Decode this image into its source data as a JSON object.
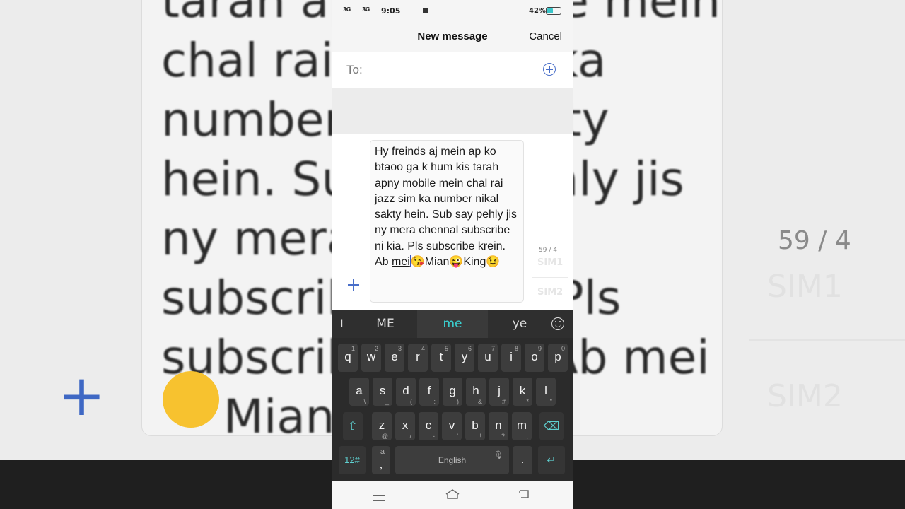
{
  "status_bar": {
    "signal_1": "3G",
    "signal_2": "3G",
    "time": "9:05",
    "battery": "42%"
  },
  "header": {
    "title": "New message",
    "cancel_label": "Cancel"
  },
  "recipient": {
    "label": "To:"
  },
  "compose": {
    "message_main": "Hy freinds aj mein  ap ko btaoo ga k hum kis tarah apny mobile mein chal rai jazz sim ka number  nikal sakty hein. Sub say pehly jis ny mera chennal subscribe  ni kia. Pls subscribe krein. Ab ",
    "message_underlined": "mei",
    "message_tail_1": "😘",
    "message_word_1": "Mian",
    "message_tail_2": "😜",
    "message_word_2": "King",
    "message_tail_3": "😉",
    "char_counter": "59 / 4",
    "sim1_label": "SIM1",
    "sim2_label": "SIM2"
  },
  "keyboard": {
    "suggestions": [
      "ME",
      "me",
      "ye"
    ],
    "row1": [
      {
        "k": "q",
        "s": "1"
      },
      {
        "k": "w",
        "s": "2"
      },
      {
        "k": "e",
        "s": "3"
      },
      {
        "k": "r",
        "s": "4"
      },
      {
        "k": "t",
        "s": "5"
      },
      {
        "k": "y",
        "s": "6"
      },
      {
        "k": "u",
        "s": "7"
      },
      {
        "k": "i",
        "s": "8"
      },
      {
        "k": "o",
        "s": "9"
      },
      {
        "k": "p",
        "s": "0"
      }
    ],
    "row2": [
      {
        "k": "a",
        "s": "\\"
      },
      {
        "k": "s",
        "s": "_"
      },
      {
        "k": "d",
        "s": "("
      },
      {
        "k": "f",
        "s": ":"
      },
      {
        "k": "g",
        "s": ")"
      },
      {
        "k": "h",
        "s": "&"
      },
      {
        "k": "j",
        "s": "#"
      },
      {
        "k": "k",
        "s": "*"
      },
      {
        "k": "l",
        "s": "\""
      }
    ],
    "row3": [
      {
        "k": "z",
        "s": "@"
      },
      {
        "k": "x",
        "s": "/"
      },
      {
        "k": "c",
        "s": "-"
      },
      {
        "k": "v",
        "s": "'"
      },
      {
        "k": "b",
        "s": "!"
      },
      {
        "k": "n",
        "s": "?"
      },
      {
        "k": "m",
        "s": ";"
      }
    ],
    "symbols_label": "12#",
    "comma_label": ",",
    "lang_key_label": "a",
    "space_label": "English",
    "period_label": "."
  },
  "background": {
    "lines": [
      "tarah apny mobile mein",
      "chal rai jazz sim ka",
      "number  nikal sakty",
      "hein. Sub say pehly jis",
      "ny mera chennal",
      "subscribe  ni kia. Pls",
      "subscribe krein. Ab mei",
      "Mian"
    ],
    "counter": "59 / 4",
    "sim1": "SIM1",
    "sim2": "SIM2"
  }
}
